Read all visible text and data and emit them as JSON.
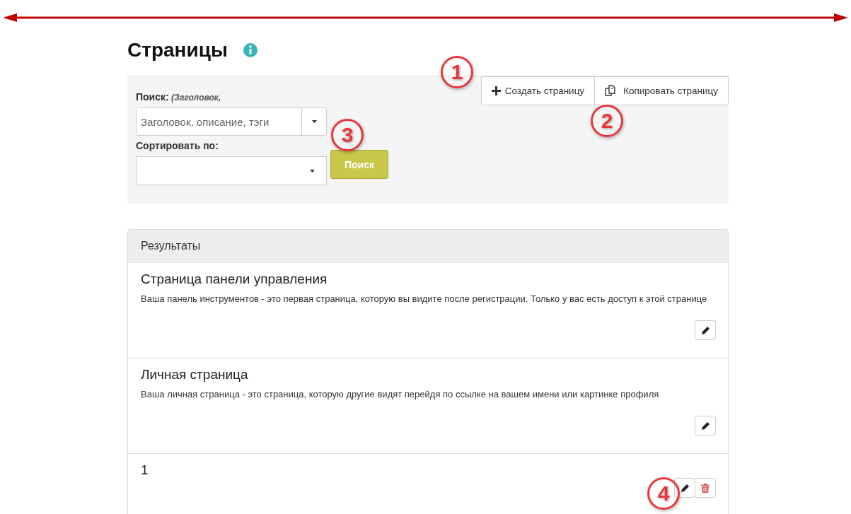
{
  "page": {
    "title": "Страницы"
  },
  "toolbar": {
    "buttons": [
      {
        "kind": "create",
        "label": "Создать страницу"
      },
      {
        "kind": "copy",
        "label": "Копировать страницу"
      }
    ]
  },
  "search": {
    "label": "Поиск:",
    "hint": "(Заголовок,",
    "placeholder": "Заголовок, описание, тэги",
    "sort_label": "Сортировать по:",
    "button": "Поиск"
  },
  "results": {
    "heading": "Результаты",
    "rows": [
      {
        "title": "Страница панели управления",
        "description": "Ваша панель инструментов - это первая страница, которую вы видите после регистрации. Только у вас есть доступ к этой странице",
        "deletable": false
      },
      {
        "title": "Личная страница",
        "description": "Ваша личная страница - это страница, которую другие видят перейдя по ссылке на вашем имени или картинке профиля",
        "deletable": false
      },
      {
        "title": "1",
        "deletable": true
      }
    ]
  },
  "callouts": [
    "1",
    "2",
    "3",
    "4"
  ]
}
